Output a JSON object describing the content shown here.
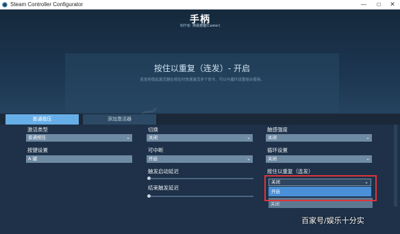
{
  "window": {
    "title": "Steam Controller Configurator",
    "min": "—",
    "max": "☐",
    "close": "✕"
  },
  "header": {
    "title": "手柄",
    "creator_label": "制作者:",
    "creator_name": "简易按键(Caster)"
  },
  "info": {
    "title": "按住以重复（连发）- 开启",
    "desc": "连发将使此激活器在按住时快速激活多个命令。可以与循环设置组合使用。"
  },
  "tabs": [
    {
      "label": "普通按压"
    },
    {
      "label": "添加激活器"
    }
  ],
  "col1": {
    "activation_type_label": "激活类型",
    "activation_type_value": "普通按压",
    "binding_label": "按键设置",
    "binding_value": "A 键"
  },
  "col2": {
    "toggle_label": "切换",
    "toggle_value": "关闭",
    "interruptible_label": "可中断",
    "interruptible_value": "开启",
    "start_delay_label": "触发启动延迟",
    "end_delay_label": "结束触发延迟"
  },
  "col3": {
    "haptic_label": "触感强度",
    "haptic_value": "关闭",
    "cycle_label": "循环设置",
    "cycle_value": "关闭",
    "repeat_label": "按住以重复（连发）",
    "repeat_value": "关闭",
    "repeat_option_on": "开启",
    "under_value": "关闭"
  },
  "watermark": "百家号/娱乐十分实",
  "icons": {
    "chevron": "chevron-down-icon"
  }
}
